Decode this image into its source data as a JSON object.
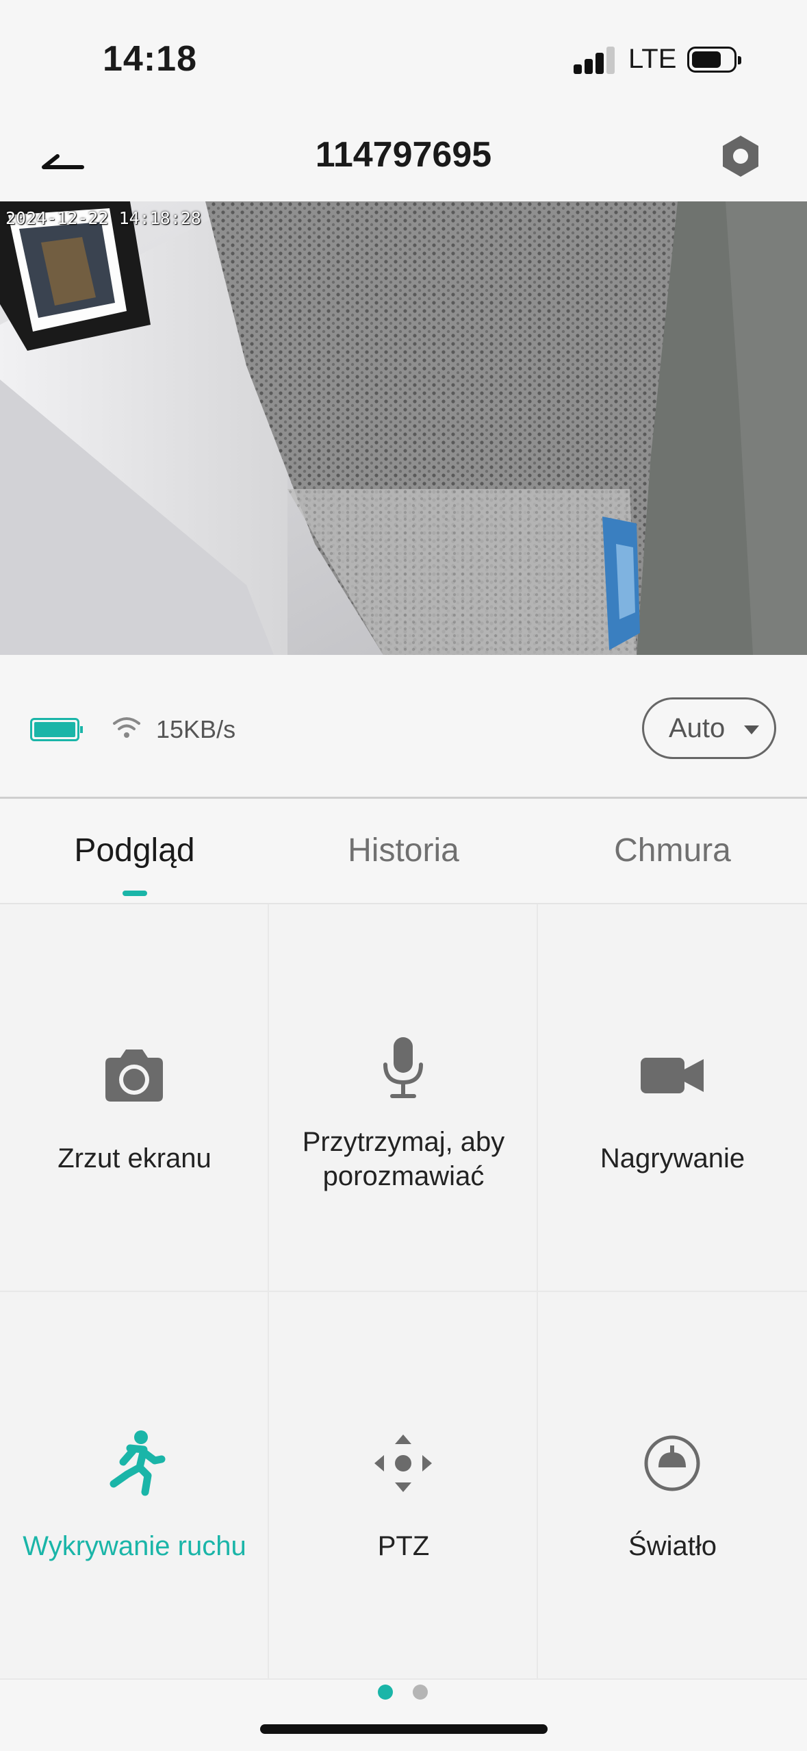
{
  "status_bar": {
    "time": "14:18",
    "network": "LTE"
  },
  "header": {
    "title": "114797695",
    "back_icon": "back-arrow-icon",
    "settings_icon": "hexagon-settings-icon"
  },
  "video": {
    "timestamp": "2024-12-22 14:18:28"
  },
  "info": {
    "speed": "15KB/s",
    "quality": "Auto",
    "battery_color": "#1ab5a8"
  },
  "tabs": [
    {
      "label": "Podgląd",
      "active": true
    },
    {
      "label": "Historia",
      "active": false
    },
    {
      "label": "Chmura",
      "active": false
    }
  ],
  "actions": [
    {
      "label": "Zrzut ekranu",
      "icon": "camera-icon"
    },
    {
      "label_line1": "Przytrzymaj, aby",
      "label_line2": "porozmawiać",
      "icon": "microphone-icon"
    },
    {
      "label": "Nagrywanie",
      "icon": "video-camera-icon"
    },
    {
      "label": "Wykrywanie ruchu",
      "icon": "running-person-icon",
      "active": true
    },
    {
      "label": "PTZ",
      "icon": "ptz-directional-icon"
    },
    {
      "label": "Światło",
      "icon": "lamp-icon"
    }
  ],
  "pager": {
    "pages": 2,
    "current": 1
  },
  "colors": {
    "accent": "#1ab5a8",
    "text": "#1a1a1a",
    "muted": "#707070"
  }
}
